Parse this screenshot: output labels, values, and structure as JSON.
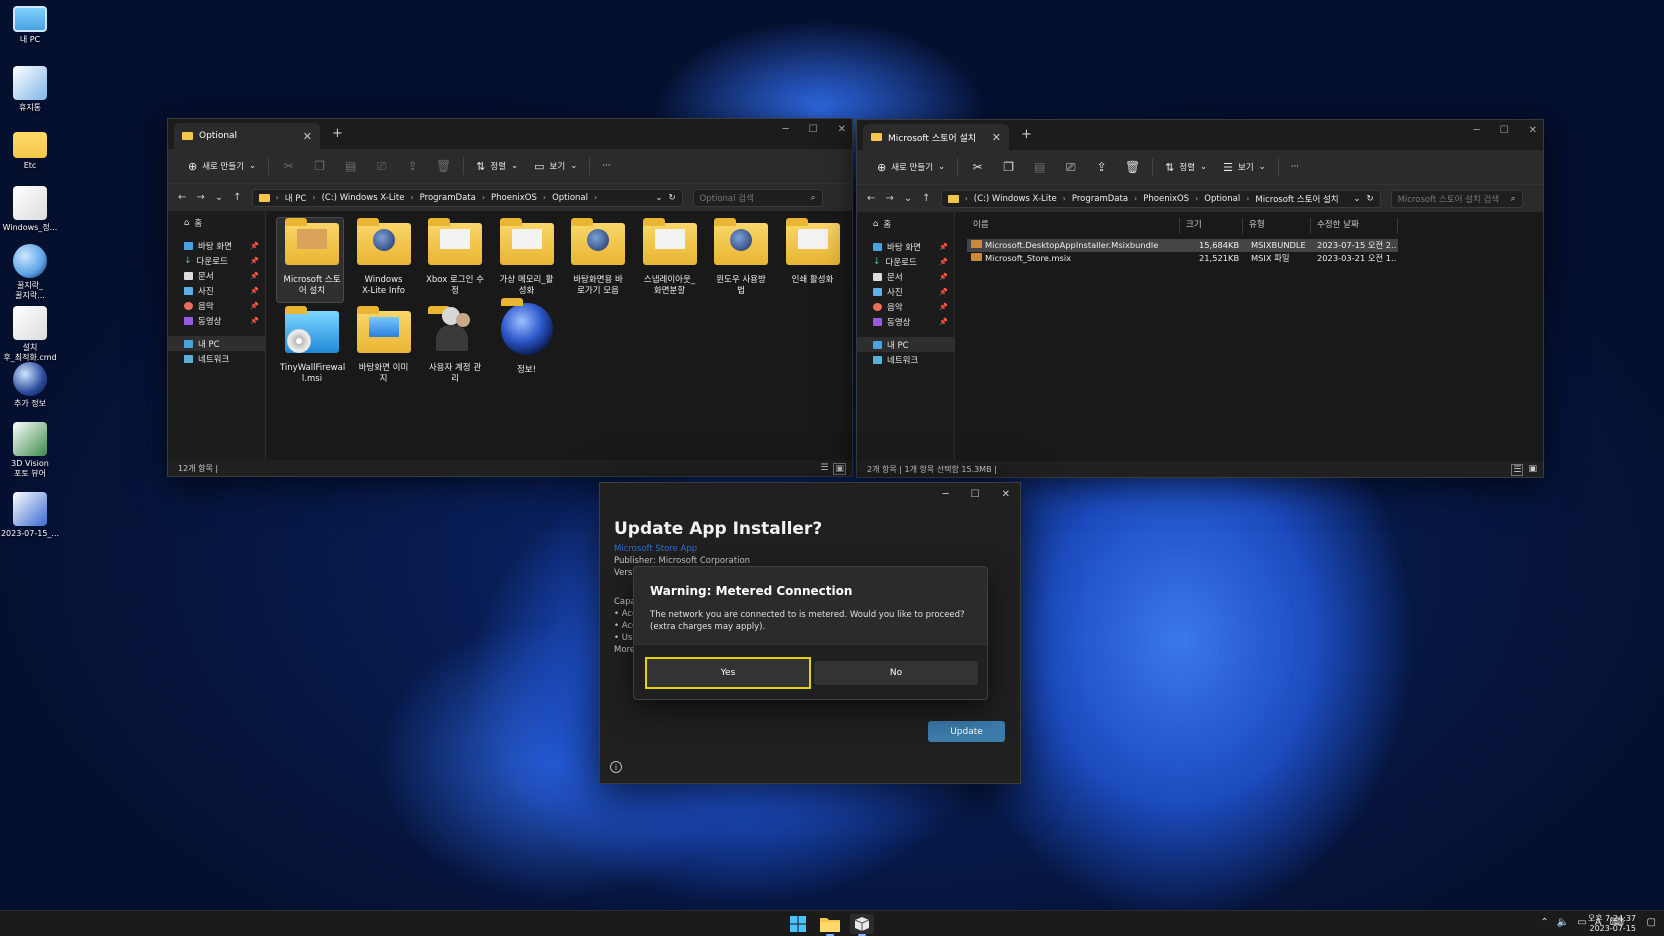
{
  "desktop": {
    "icons": [
      {
        "label": "내 PC",
        "icon": "monitor-icon",
        "color": "#4aa3e0"
      },
      {
        "label": "휴지통",
        "icon": "recycle-bin-icon",
        "color": "#7fb6e8"
      },
      {
        "label": "Etc",
        "icon": "folder-icon",
        "color": "#f4c74a"
      },
      {
        "label": "Windows_정...",
        "icon": "settings-file-icon",
        "color": "#dcdcdc"
      },
      {
        "label": "꿀지락_\n꿀지락...",
        "icon": "globe-icon",
        "color": "#5aa2e6"
      },
      {
        "label": "설치\n후_최적화.cmd",
        "icon": "settings-file-icon",
        "color": "#dcdcdc"
      },
      {
        "label": "추가 정보",
        "icon": "xlite-logo-icon",
        "color": "#2a4a9a"
      },
      {
        "label": "3D Vision\n포토 뷰어",
        "icon": "photo-viewer-icon",
        "color": "#3b8a4a"
      },
      {
        "label": "2023-07-15_...",
        "icon": "image-file-icon",
        "color": "#3a6ad0"
      }
    ]
  },
  "explorer_left": {
    "tab_title": "Optional",
    "toolbar": {
      "new": "새로 만들기",
      "sort": "정렬",
      "view": "보기",
      "more": "···"
    },
    "breadcrumb": [
      "내 PC",
      "(C:) Windows X-Lite",
      "ProgramData",
      "PhoenixOS",
      "Optional"
    ],
    "search_placeholder": "Optional 검색",
    "nav": {
      "home": "홈",
      "quick": [
        "바탕 화면",
        "다운로드",
        "문서",
        "사진",
        "음악",
        "동영상"
      ],
      "pc": "내 PC",
      "network": "네트워크"
    },
    "items": [
      {
        "label": "Microsoft 스토\n어 설치",
        "kind": "folder-box"
      },
      {
        "label": "Windows\nX-Lite Info",
        "kind": "folder-logo"
      },
      {
        "label": "Xbox 로그인 수\n정",
        "kind": "folder-doc"
      },
      {
        "label": "가상 메모리_활\n성화",
        "kind": "folder-doc"
      },
      {
        "label": "바탕화면용 바\n로가기 모음",
        "kind": "folder-user"
      },
      {
        "label": "스냅레이아웃_\n화면분할",
        "kind": "folder-doc"
      },
      {
        "label": "윈도우 사용방\n법",
        "kind": "folder-logo"
      },
      {
        "label": "인쇄 활성화",
        "kind": "folder-doc"
      },
      {
        "label": "TinyWallFirewal\nl.msi",
        "kind": "installer"
      },
      {
        "label": "바탕화면 이미\n지",
        "kind": "folder-image"
      },
      {
        "label": "사용자 계정 관\n리",
        "kind": "users"
      },
      {
        "label": "정보!",
        "kind": "logo"
      }
    ],
    "status": "12개 항목  |"
  },
  "explorer_right": {
    "tab_title": "Microsoft 스토어 설치",
    "toolbar": {
      "new": "새로 만들기",
      "sort": "정렬",
      "view": "보기",
      "more": "···"
    },
    "breadcrumb": [
      "(C:) Windows X-Lite",
      "ProgramData",
      "PhoenixOS",
      "Optional",
      "Microsoft 스토어 설치"
    ],
    "search_placeholder": "Microsoft 스토어 설치 검색",
    "nav": {
      "home": "홈",
      "quick": [
        "바탕 화면",
        "다운로드",
        "문서",
        "사진",
        "음악",
        "동영상"
      ],
      "pc": "내 PC",
      "network": "네트워크"
    },
    "columns": [
      "이름",
      "크기",
      "유형",
      "수정한 날짜"
    ],
    "files": [
      {
        "name": "Microsoft.DesktopAppInstaller.Msixbundle",
        "size": "15,684KB",
        "type": "MSIXBUNDLE ...",
        "date": "2023-07-15 오전 2..."
      },
      {
        "name": "Microsoft_Store.msix",
        "size": "21,521KB",
        "type": "MSIX 파일",
        "date": "2023-03-21 오전 1..."
      }
    ],
    "status": "2개 항목  |  1개 항목 선택함 15.3MB  |"
  },
  "installer_dialog": {
    "title": "Update App Installer?",
    "link": "Microsoft Store App",
    "publisher": "Publisher: Microsoft Corporation",
    "version": "Versi",
    "capabilities": [
      "Capa",
      "• Acc",
      "• Acc",
      "• Use",
      "More"
    ],
    "update_label": "Update"
  },
  "warning_dialog": {
    "title": "Warning: Metered Connection",
    "message": "The network you are connected to is metered. Would you like to proceed? (extra charges may apply).",
    "yes": "Yes",
    "no": "No"
  },
  "taskbar": {
    "time": "오후 7:24:37",
    "date": "2023-07-15",
    "ime": "A"
  },
  "colors": {
    "accent": "#3d7cab",
    "focus": "#e5d400",
    "folder": "#f4c74a"
  }
}
